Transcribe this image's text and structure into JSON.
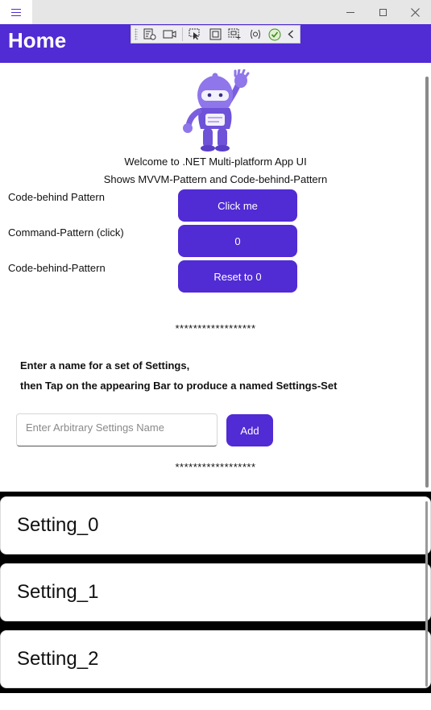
{
  "window": {
    "menu_icon": "hamburger-icon",
    "controls": [
      "minimize-icon",
      "maximize-icon",
      "close-icon"
    ]
  },
  "header": {
    "title": "Home"
  },
  "debug_toolbar": {
    "icons": [
      "grip-icon",
      "live-visual-tree-icon",
      "record-icon",
      "select-element-icon",
      "display-layout-adorners-icon",
      "track-focus-icon",
      "binding-failures-icon",
      "hot-reload-ok-icon",
      "collapse-icon"
    ]
  },
  "main": {
    "logo_icon": "dotnet-bot-icon",
    "welcome": "Welcome to .NET Multi-platform App UI",
    "subtitle": "Shows MVVM-Pattern and Code-behind-Pattern",
    "rows": [
      {
        "label": "Code-behind Pattern",
        "button": "Click me"
      },
      {
        "label": "Command-Pattern (click)",
        "button": "0"
      },
      {
        "label": "Code-behind-Pattern",
        "button": "Reset to 0"
      }
    ],
    "stars_top": "******************",
    "instruction_1": "Enter a name for a set of Settings,",
    "instruction_2": "then Tap on the appearing Bar to produce a named Settings-Set",
    "settings_name_placeholder": "Enter Arbitrary Settings Name",
    "settings_name_value": "",
    "add_label": "Add",
    "stars_bottom": "******************"
  },
  "settings_list": [
    "Setting_0",
    "Setting_1",
    "Setting_2"
  ],
  "colors": {
    "accent": "#512bd4",
    "titlebar": "#e6e6e6",
    "list_background": "#000000"
  }
}
